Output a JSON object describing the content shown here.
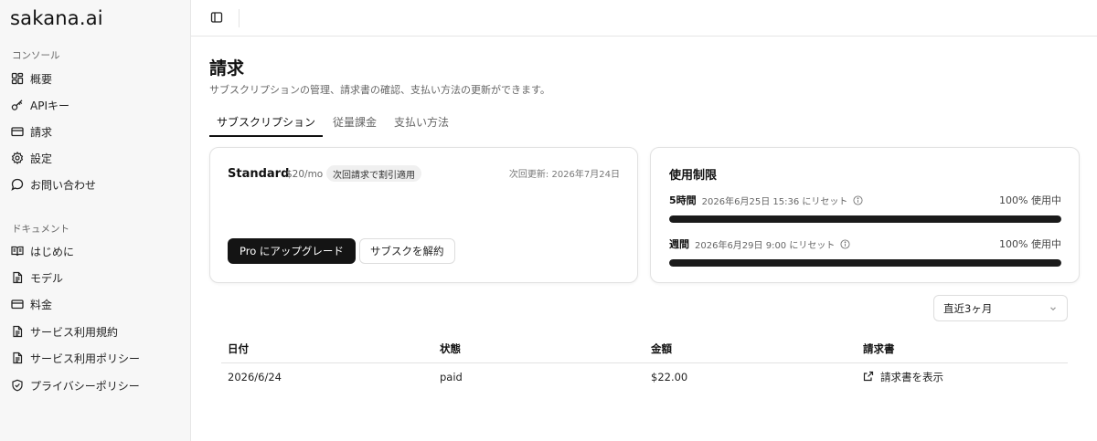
{
  "brand": {
    "logo": "sakana.ai"
  },
  "sidebar": {
    "console_label": "コンソール",
    "console_items": [
      {
        "label": "概要",
        "icon": "dashboard-icon"
      },
      {
        "label": "APIキー",
        "icon": "key-icon"
      },
      {
        "label": "請求",
        "icon": "credit-card-icon"
      },
      {
        "label": "設定",
        "icon": "gear-icon"
      },
      {
        "label": "お問い合わせ",
        "icon": "chat-bubble-icon"
      }
    ],
    "docs_label": "ドキュメント",
    "docs_items": [
      {
        "label": "はじめに",
        "icon": "book-open-icon"
      },
      {
        "label": "モデル",
        "icon": "document-icon"
      },
      {
        "label": "料金",
        "icon": "credit-card-icon"
      },
      {
        "label": "サービス利用規約",
        "icon": "document-icon"
      },
      {
        "label": "サービス利用ポリシー",
        "icon": "document-icon"
      },
      {
        "label": "プライバシーポリシー",
        "icon": "shield-icon"
      }
    ]
  },
  "page": {
    "title": "請求",
    "subtitle": "サブスクリプションの管理、請求書の確認、支払い方法の更新ができます。"
  },
  "tabs": [
    {
      "label": "サブスクリプション",
      "active": true
    },
    {
      "label": "従量課金",
      "active": false
    },
    {
      "label": "支払い方法",
      "active": false
    }
  ],
  "plan": {
    "name": "Standard",
    "price": "$20/mo",
    "badge": "次回請求で割引適用",
    "next_update": "次回更新: 2026年7月24日",
    "upgrade_label": "Pro にアップグレード",
    "cancel_label": "サブスクを解約"
  },
  "usage": {
    "title": "使用制限",
    "rows": [
      {
        "label": "5時間",
        "reset": "2026年6月25日 15:36 にリセット",
        "percent_text": "100% 使用中",
        "fraction": 1.0
      },
      {
        "label": "週間",
        "reset": "2026年6月29日 9:00 にリセット",
        "percent_text": "100% 使用中",
        "fraction": 1.0
      }
    ]
  },
  "filter": {
    "selected": "直近3ヶ月"
  },
  "invoices": {
    "headers": [
      "日付",
      "状態",
      "金額",
      "請求書"
    ],
    "rows": [
      {
        "date": "2026/6/24",
        "status": "paid",
        "amount": "$22.00",
        "link": "請求書を表示"
      }
    ]
  },
  "colors": {
    "primary": "#141414",
    "bar_track": "#e8e8e8",
    "sidebar_bg": "#f7f7f7"
  }
}
